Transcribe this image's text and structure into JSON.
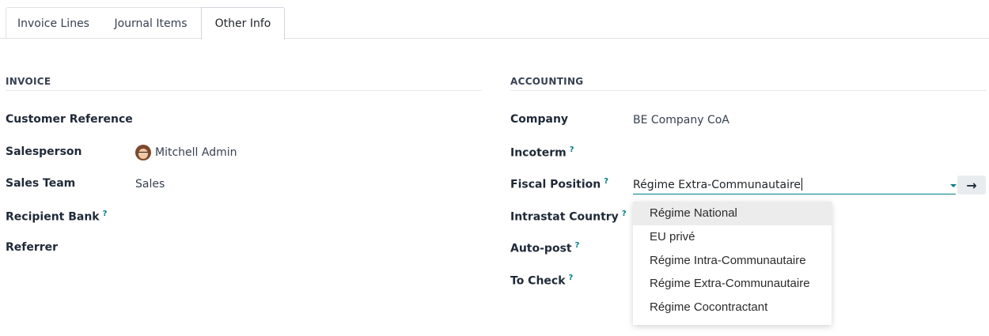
{
  "tabs": [
    {
      "label": "Invoice Lines"
    },
    {
      "label": "Journal Items"
    },
    {
      "label": "Other Info"
    }
  ],
  "invoice": {
    "title": "INVOICE",
    "customer_reference_label": "Customer Reference",
    "salesperson_label": "Salesperson",
    "salesperson_value": "Mitchell Admin",
    "sales_team_label": "Sales Team",
    "sales_team_value": "Sales",
    "recipient_bank_label": "Recipient Bank",
    "referrer_label": "Referrer"
  },
  "accounting": {
    "title": "ACCOUNTING",
    "company_label": "Company",
    "company_value": "BE Company CoA",
    "incoterm_label": "Incoterm",
    "fiscal_position_label": "Fiscal Position",
    "fiscal_position_value": "Régime Extra-Communautaire",
    "intrastat_country_label": "Intrastat Country",
    "auto_post_label": "Auto-post",
    "to_check_label": "To Check"
  },
  "help_mark": "?",
  "dropdown": {
    "options": [
      "Régime National",
      "EU privé",
      "Régime Intra-Communautaire",
      "Régime Extra-Communautaire",
      "Régime Cocontractant"
    ]
  },
  "colors": {
    "accent": "#017e84"
  },
  "icons": {
    "goto": "arrow-right-icon",
    "dropdown": "caret-down-icon",
    "avatar": "user-avatar"
  }
}
